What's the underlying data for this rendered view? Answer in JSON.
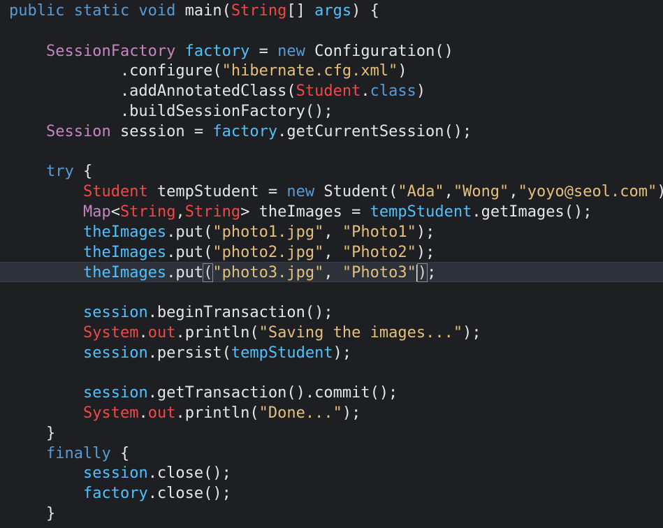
{
  "editor": {
    "colors": {
      "background": "#1e1f22",
      "keyword": "#569cd6",
      "type": "#c586c0",
      "class": "#f44747",
      "variable": "#4fc1ff",
      "string": "#e5c07b",
      "plain": "#e6e6e6",
      "current_line": "#2c313a"
    },
    "current_line_index": 13,
    "lines": [
      [
        [
          "kw",
          "public static void "
        ],
        [
          "pl",
          "main("
        ],
        [
          "cls",
          "String"
        ],
        [
          "pl",
          "[] "
        ],
        [
          "var",
          "args"
        ],
        [
          "pl",
          ") {"
        ]
      ],
      [],
      [
        [
          "pl",
          "    "
        ],
        [
          "ty",
          "SessionFactory"
        ],
        [
          "pl",
          " "
        ],
        [
          "var",
          "factory"
        ],
        [
          "pl",
          " = "
        ],
        [
          "kw",
          "new"
        ],
        [
          "pl",
          " Configuration()"
        ]
      ],
      [
        [
          "pl",
          "            .configure("
        ],
        [
          "str",
          "\"hibernate.cfg.xml\""
        ],
        [
          "pl",
          ")"
        ]
      ],
      [
        [
          "pl",
          "            .addAnnotatedClass("
        ],
        [
          "cls",
          "Student"
        ],
        [
          "pl",
          "."
        ],
        [
          "kw",
          "class"
        ],
        [
          "pl",
          ")"
        ]
      ],
      [
        [
          "pl",
          "            .buildSessionFactory();"
        ]
      ],
      [
        [
          "pl",
          "    "
        ],
        [
          "ty",
          "Session"
        ],
        [
          "pl",
          " session = "
        ],
        [
          "var",
          "factory"
        ],
        [
          "pl",
          ".getCurrentSession();"
        ]
      ],
      [],
      [
        [
          "pl",
          "    "
        ],
        [
          "kw",
          "try"
        ],
        [
          "pl",
          " {"
        ]
      ],
      [
        [
          "pl",
          "        "
        ],
        [
          "cls",
          "Student"
        ],
        [
          "pl",
          " tempStudent = "
        ],
        [
          "kw",
          "new"
        ],
        [
          "pl",
          " Student("
        ],
        [
          "str",
          "\"Ada\""
        ],
        [
          "pl",
          ","
        ],
        [
          "str",
          "\"Wong\""
        ],
        [
          "pl",
          ","
        ],
        [
          "str",
          "\"yoyo@seol.com\""
        ],
        [
          "pl",
          ");"
        ]
      ],
      [
        [
          "pl",
          "        "
        ],
        [
          "ty",
          "Map"
        ],
        [
          "pl",
          "<"
        ],
        [
          "cls",
          "String"
        ],
        [
          "pl",
          ","
        ],
        [
          "cls",
          "String"
        ],
        [
          "pl",
          "> theImages = "
        ],
        [
          "var",
          "tempStudent"
        ],
        [
          "pl",
          ".getImages();"
        ]
      ],
      [
        [
          "pl",
          "        "
        ],
        [
          "var",
          "theImages"
        ],
        [
          "pl",
          ".put("
        ],
        [
          "str",
          "\"photo1.jpg\""
        ],
        [
          "pl",
          ", "
        ],
        [
          "str",
          "\"Photo1\""
        ],
        [
          "pl",
          ");"
        ]
      ],
      [
        [
          "pl",
          "        "
        ],
        [
          "var",
          "theImages"
        ],
        [
          "pl",
          ".put("
        ],
        [
          "str",
          "\"photo2.jpg\""
        ],
        [
          "pl",
          ", "
        ],
        [
          "str",
          "\"Photo2\""
        ],
        [
          "pl",
          ");"
        ]
      ],
      [
        [
          "pl",
          "        "
        ],
        [
          "var",
          "theImages"
        ],
        [
          "pl",
          ".put"
        ],
        [
          "br",
          "("
        ],
        [
          "str",
          "\"photo3.jpg\""
        ],
        [
          "pl",
          ", "
        ],
        [
          "str",
          "\"Photo3\""
        ],
        [
          "caret",
          ""
        ],
        [
          "br",
          ")"
        ],
        [
          "pl",
          ";"
        ]
      ],
      [],
      [
        [
          "pl",
          "        "
        ],
        [
          "var",
          "session"
        ],
        [
          "pl",
          ".beginTransaction();"
        ]
      ],
      [
        [
          "pl",
          "        "
        ],
        [
          "cls",
          "System"
        ],
        [
          "pl",
          "."
        ],
        [
          "cls",
          "out"
        ],
        [
          "pl",
          ".println("
        ],
        [
          "str",
          "\"Saving the images...\""
        ],
        [
          "pl",
          ");"
        ]
      ],
      [
        [
          "pl",
          "        "
        ],
        [
          "var",
          "session"
        ],
        [
          "pl",
          ".persist("
        ],
        [
          "var",
          "tempStudent"
        ],
        [
          "pl",
          ");"
        ]
      ],
      [],
      [
        [
          "pl",
          "        "
        ],
        [
          "var",
          "session"
        ],
        [
          "pl",
          ".getTransaction().commit();"
        ]
      ],
      [
        [
          "pl",
          "        "
        ],
        [
          "cls",
          "System"
        ],
        [
          "pl",
          "."
        ],
        [
          "cls",
          "out"
        ],
        [
          "pl",
          ".println("
        ],
        [
          "str",
          "\"Done...\""
        ],
        [
          "pl",
          ");"
        ]
      ],
      [
        [
          "pl",
          "    }"
        ]
      ],
      [
        [
          "pl",
          "    "
        ],
        [
          "kw",
          "finally"
        ],
        [
          "pl",
          " {"
        ]
      ],
      [
        [
          "pl",
          "        "
        ],
        [
          "var",
          "session"
        ],
        [
          "pl",
          ".close();"
        ]
      ],
      [
        [
          "pl",
          "        "
        ],
        [
          "var",
          "factory"
        ],
        [
          "pl",
          ".close();"
        ]
      ],
      [
        [
          "pl",
          "    }"
        ]
      ]
    ]
  }
}
